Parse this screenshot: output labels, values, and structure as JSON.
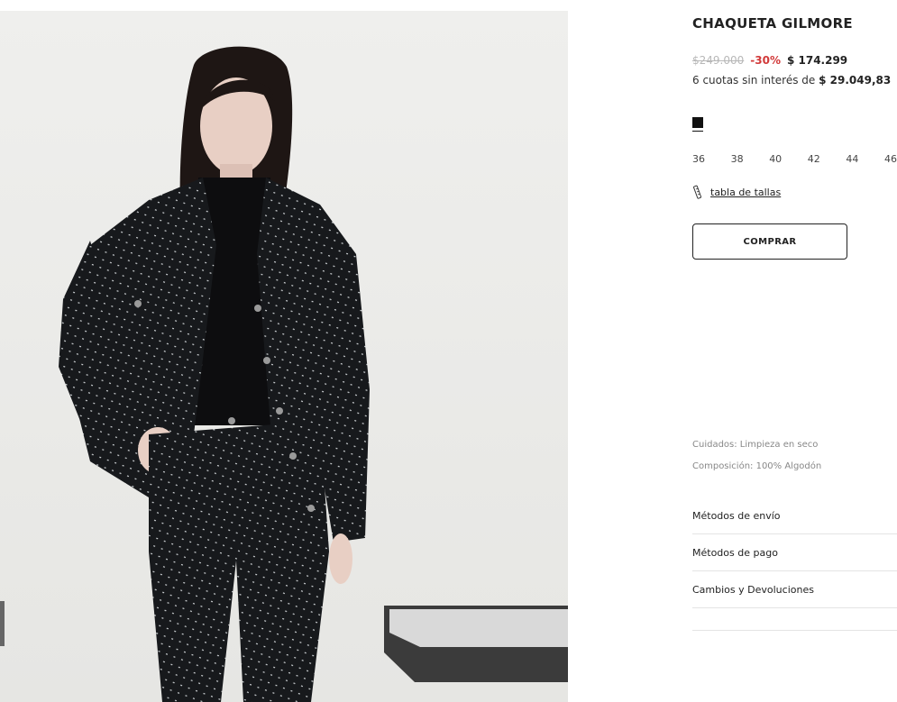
{
  "product": {
    "title": "CHAQUETA GILMORE",
    "old_price": "$249.000",
    "discount": "-30%",
    "price": "$ 174.299",
    "installments_text": "6 cuotas sin interés de",
    "installments_amount": "$ 29.049,83",
    "color_swatch": "#111111",
    "sizes": [
      "36",
      "38",
      "40",
      "42",
      "44",
      "46"
    ],
    "size_table_label": "tabla de tallas",
    "buy_label": "COMPRAR",
    "care": "Cuidados: Limpieza en seco",
    "composition": "Composición: 100% Algodón"
  },
  "accordion": [
    {
      "label": "Métodos de envío"
    },
    {
      "label": "Métodos de pago"
    },
    {
      "label": "Cambios y Devoluciones"
    }
  ],
  "icons": {
    "size_table": "ruler-icon"
  }
}
